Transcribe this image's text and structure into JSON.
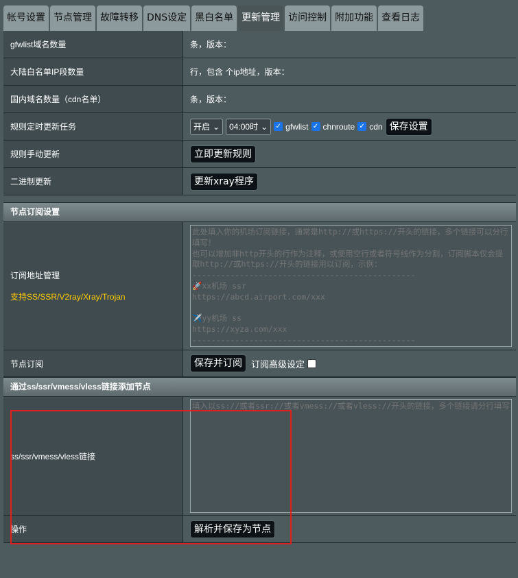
{
  "tabs": [
    "帐号设置",
    "节点管理",
    "故障转移",
    "DNS设定",
    "黑白名单",
    "更新管理",
    "访问控制",
    "附加功能",
    "查看日志"
  ],
  "active_tab": "更新管理",
  "rows": {
    "gfwlist_label": "gfwlist域名数量",
    "gfwlist_value": "条，版本：",
    "chnroute_label": "大陆白名单IP段数量",
    "chnroute_value": "行，包含 个ip地址，版本：",
    "cdn_label": "国内域名数量（cdn名单）",
    "cdn_value": "条，版本：",
    "schedule_label": "规则定时更新任务",
    "schedule_enable": "开启",
    "schedule_time": "04:00时",
    "chk_gfwlist": "gfwlist",
    "chk_chnroute": "chnroute",
    "chk_cdn": "cdn",
    "save_settings": "保存设置",
    "manual_label": "规则手动更新",
    "manual_button": "立即更新规则",
    "binary_label": "二进制更新",
    "binary_button": "更新xray程序"
  },
  "subscribe": {
    "section_title": "节点订阅设置",
    "url_label": "订阅地址管理",
    "url_sublabel": "支持SS/SSR/V2ray/Xray/Trojan",
    "placeholder": "此处填入你的机场订阅链接，通常是http://或https://开头的链接，多个链接可以分行填写！\n也可以增加非http开头的行作为注释，或使用空行或者符号线作为分割，订阅脚本仅会提取http://或https://开头的链接用以订阅，示例：\n-----------------------------------------------\n🚀xx机场 ssr\nhttps://abcd.airport.com/xxx\n\n✈️yy机场 ss\nhttps://xyza.com/xxx\n-----------------------------------------------\n填写完成后点击下面的【保存并订阅】按钮开始订阅！",
    "node_label": "节点订阅",
    "node_button": "保存并订阅",
    "advanced_label": "订阅高级设定"
  },
  "link_add": {
    "section_title": "通过ss/ssr/vmess/vless链接添加节点",
    "link_label": "ss/ssr/vmess/vless链接",
    "placeholder": "填入以ss://或者ssr://或者vmess://或者vless://开头的链接，多个链接请分行填写",
    "op_label": "操作",
    "op_button": "解析并保存为节点"
  },
  "colors": {
    "highlight_box": "#e02020",
    "checkbox": "#1a73e8",
    "note": "#ffcc00"
  }
}
